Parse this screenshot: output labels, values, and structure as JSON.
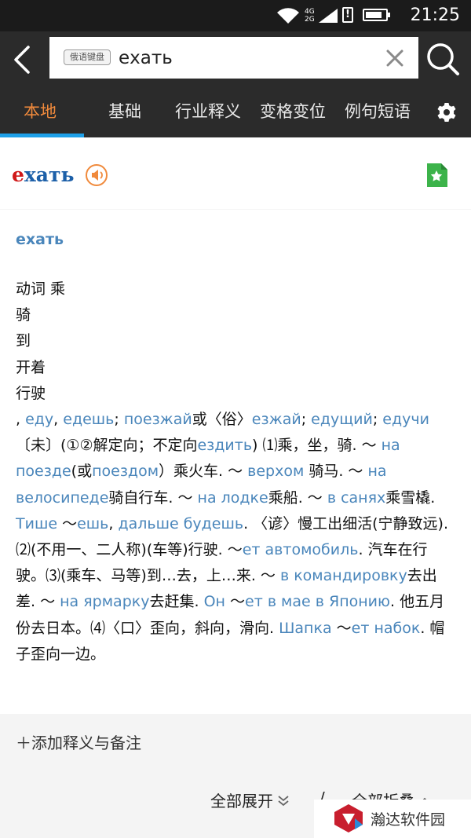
{
  "status_bar": {
    "time": "21:25",
    "network_top": "4G",
    "network_bottom": "2G",
    "alert_symbol": "!",
    "battery_level": 0.82,
    "icons": [
      "wifi-icon",
      "cellular-icon",
      "alert-icon",
      "battery-icon"
    ]
  },
  "search": {
    "keyboard_badge": "俄语键盘",
    "query": "ехать"
  },
  "tabs": [
    {
      "label": "本地",
      "active": true
    },
    {
      "label": "基础",
      "active": false
    },
    {
      "label": "行业释义",
      "active": false
    },
    {
      "label": "变格变位",
      "active": false
    },
    {
      "label": "例句短语",
      "active": false
    }
  ],
  "headword": {
    "first_letter": "е",
    "rest": "хать"
  },
  "definition": {
    "headword": "ехать",
    "senses": [
      "动词 乘",
      "骑",
      "到",
      "开着",
      "行驶"
    ],
    "segments": [
      {
        "t": ", ",
        "ru": false
      },
      {
        "t": "еду",
        "ru": true
      },
      {
        "t": ", ",
        "ru": false
      },
      {
        "t": "едешь",
        "ru": true
      },
      {
        "t": "; ",
        "ru": false
      },
      {
        "t": "поезжай",
        "ru": true
      },
      {
        "t": "或〈俗〉",
        "ru": false
      },
      {
        "t": "езжай",
        "ru": true
      },
      {
        "t": "; ",
        "ru": false
      },
      {
        "t": "едущий",
        "ru": true
      },
      {
        "t": "; ",
        "ru": false
      },
      {
        "t": "едучи",
        "ru": true
      },
      {
        "t": "〔未〕(①②解定向；不定向",
        "ru": false
      },
      {
        "t": "ездить",
        "ru": true
      },
      {
        "t": ") ⑴乘，坐，骑. ～ ",
        "ru": false
      },
      {
        "t": "на поезде",
        "ru": true
      },
      {
        "t": "(或",
        "ru": false
      },
      {
        "t": "поездом",
        "ru": true
      },
      {
        "t": "）乘火车. ～ ",
        "ru": false
      },
      {
        "t": "верхом",
        "ru": true
      },
      {
        "t": " 骑马. ～ ",
        "ru": false
      },
      {
        "t": "на велосипеде",
        "ru": true
      },
      {
        "t": "骑自行车. ～ ",
        "ru": false
      },
      {
        "t": "на лодке",
        "ru": true
      },
      {
        "t": "乘船. ～ ",
        "ru": false
      },
      {
        "t": "в санях",
        "ru": true
      },
      {
        "t": "乘雪橇. ",
        "ru": false
      },
      {
        "t": "Тише",
        "ru": true
      },
      {
        "t": " ～",
        "ru": false
      },
      {
        "t": "ешь",
        "ru": true
      },
      {
        "t": ", ",
        "ru": false
      },
      {
        "t": "дальше будешь",
        "ru": true
      },
      {
        "t": ". 〈谚〉慢工出细活(宁静致远). ⑵(不用一、二人称)(车等)行驶. ～",
        "ru": false
      },
      {
        "t": "ет автомобиль",
        "ru": true
      },
      {
        "t": ". 汽车在行驶。⑶(乘车、马等)到…去，上…来. ～ ",
        "ru": false
      },
      {
        "t": "в командировку",
        "ru": true
      },
      {
        "t": "去出差. ～ ",
        "ru": false
      },
      {
        "t": "на ярмарку",
        "ru": true
      },
      {
        "t": "去赶集. ",
        "ru": false
      },
      {
        "t": "Он",
        "ru": true
      },
      {
        "t": " ～",
        "ru": false
      },
      {
        "t": "ет в мае в Японию",
        "ru": true
      },
      {
        "t": ". 他五月份去日本。⑷〈口〉歪向，斜向，滑向. ",
        "ru": false
      },
      {
        "t": "Шапка",
        "ru": true
      },
      {
        "t": " ～",
        "ru": false
      },
      {
        "t": "ет набок",
        "ru": true
      },
      {
        "t": ". 帽子歪向一边。",
        "ru": false
      }
    ]
  },
  "actions": {
    "add_note": "＋添加释义与备注",
    "expand_all": "全部展开",
    "separator": "/",
    "collapse_all": "全部折叠"
  },
  "watermark": {
    "text": "瀚达软件园"
  },
  "colors": {
    "accent_orange": "#f08a3c",
    "tab_underline": "#1ea0e8",
    "russian_link": "#4a86bb",
    "headword_red": "#d01818",
    "headword_blue": "#1c5fa8",
    "favorite_green": "#3cb34a"
  }
}
